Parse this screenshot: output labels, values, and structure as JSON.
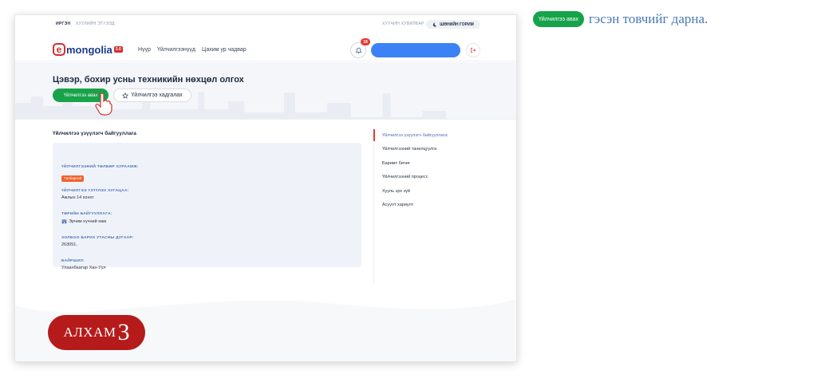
{
  "topbar": {
    "citizen_label": "ИРГЭН",
    "legal_label": "ХУУЛИЙН ЭТГЭЭД",
    "help_label": "ХУУЧИН ХУВИЛБАР",
    "dark_mode_label": "ШӨНИЙН ГОРИМ"
  },
  "navbar": {
    "logo_letter": "e",
    "logo_word": "mongolia",
    "logo_version": "3.0",
    "menu": [
      "Нүүр",
      "Үйлчилгээнүүд",
      "Цахим ур чадвар"
    ],
    "notification_count": "18"
  },
  "hero": {
    "title": "Цэвэр, бохир усны техникийн нөхцөл олгох",
    "primary_button": "Үйлчилгээ авах",
    "secondary_button": "Үйлчилгээ хадгалах"
  },
  "info": {
    "section_title": "Үйлчилгээ үзүүлэгч байгууллага",
    "fields": [
      {
        "label": "ҮЙЛЧИЛГЭЭНИЙ ТӨЛБӨР ХУРААМЖ:",
        "value": "Төлбөртэй"
      },
      {
        "label": "ҮЙЛЧИЛГЭЭ ҮЗҮҮЛЭХ ХУГАЦАА:",
        "value": "Ажлын 14 хоног"
      },
      {
        "label": "ТӨРИЙН БАЙГУУЛЛАГА:",
        "value": "Эрчим хүчний яам"
      },
      {
        "label": "ХОЛБОО БАРИХ УТАСНЫ ДУГААР:",
        "value": "263051,"
      },
      {
        "label": "БАЙРШИЛ:",
        "value": "Улаанбаатар Хан-Уул"
      }
    ]
  },
  "side_nav": [
    "Үйлчилгээ үзүүлэгч байгууллага",
    "Үйлчилгээний танилцуулга",
    "Баримт бичиг",
    "Үйлчилгээний процесс",
    "Хууль эрх зүй",
    "Асуулт хариулт"
  ],
  "step": {
    "word": "АЛХАМ",
    "number": "3"
  },
  "instruction": {
    "button_label": "Үйлчилгээ авах",
    "text": "гэсэн товчийг дарна."
  },
  "colors": {
    "primary_green": "#16a34a",
    "brand_red": "#d32f2f",
    "step_red": "#b51b1b",
    "accent_blue": "#3b82f6",
    "instruction_blue": "#4a79b3"
  }
}
